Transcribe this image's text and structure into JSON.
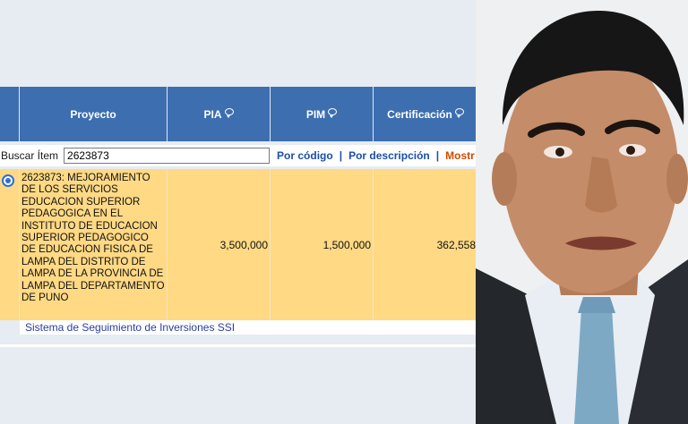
{
  "table": {
    "columns": {
      "proyecto": "Proyecto",
      "pia": "PIA",
      "pim": "PIM",
      "certificacion": "Certificación"
    }
  },
  "search": {
    "label": "Buscar Ítem",
    "value": "2623873",
    "by_code": "Por código",
    "separator": "|",
    "by_description": "Por descripción",
    "show": "Mostr"
  },
  "row": {
    "description": "2623873: MEJORAMIENTO DE LOS SERVICIOS EDUCACION SUPERIOR PEDAGOGICA EN EL INSTITUTO DE EDUCACION SUPERIOR PEDAGOGICO DE EDUCACION FISICA DE LAMPA DEL DISTRITO DE LAMPA DE LA PROVINCIA DE LAMPA DEL DEPARTAMENTO DE PUNO",
    "pia": "3,500,000",
    "pim": "1,500,000",
    "certificacion": "362,558"
  },
  "footer": {
    "text": "Sistema de Seguimiento de Inversiones SSI"
  },
  "colors": {
    "header_bg": "#3d6eb0",
    "row_highlight": "#ffd984",
    "link": "#1b4fa8",
    "link_accent": "#d24a00"
  },
  "icons": [
    "help-icon",
    "radio-selected"
  ]
}
